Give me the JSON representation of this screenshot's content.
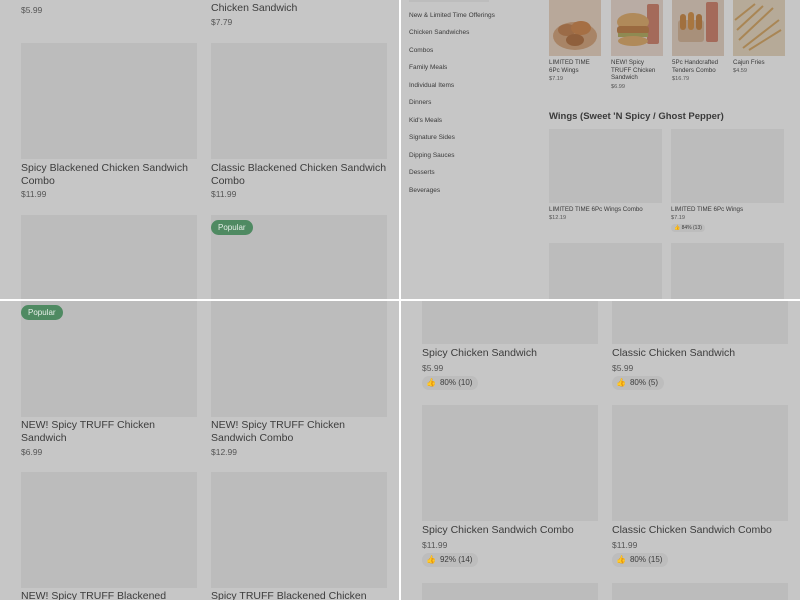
{
  "q1": {
    "top_row": [
      {
        "name": "",
        "price": "$5.99"
      },
      {
        "name": "Chicken Sandwich",
        "price": "$7.79"
      }
    ],
    "items": [
      {
        "name": "Spicy Blackened Chicken Sandwich Combo",
        "price": "$11.99"
      },
      {
        "name": "Classic Blackened Chicken Sandwich Combo",
        "price": "$11.99"
      }
    ],
    "popular_badge": "Popular"
  },
  "q2": {
    "sidebar": [
      "New & Limited Time Offerings",
      "Chicken Sandwiches",
      "Combos",
      "Family Meals",
      "Individual Items",
      "Dinners",
      "Kid's Meals",
      "Signature Sides",
      "Dipping Sauces",
      "Desserts",
      "Beverages"
    ],
    "featured": [
      {
        "name": "LIMITED TIME 6Pc Wings",
        "price": "$7.19"
      },
      {
        "name": "NEW! Spicy TRUFF Chicken Sandwich",
        "price": "$6.99"
      },
      {
        "name": "5Pc Handcrafted Tenders Combo",
        "price": "$16.79"
      },
      {
        "name": "Cajun Fries",
        "price": "$4.59"
      }
    ],
    "section_title": "Wings (Sweet 'N Spicy / Ghost Pepper)",
    "wings": [
      {
        "name": "LIMITED TIME 6Pc Wings Combo",
        "price": "$12.19",
        "rating": ""
      },
      {
        "name": "LIMITED TIME 6Pc Wings",
        "price": "$7.19",
        "rating": "84% (13)"
      }
    ]
  },
  "q3": {
    "popular_badge": "Popular",
    "items": [
      {
        "name": "NEW! Spicy TRUFF Chicken Sandwich",
        "price": "$6.99"
      },
      {
        "name": "NEW! Spicy TRUFF Chicken Sandwich Combo",
        "price": "$12.99"
      },
      {
        "name": "NEW! Spicy TRUFF Blackened",
        "price": ""
      },
      {
        "name": "Spicy TRUFF Blackened Chicken",
        "price": ""
      }
    ]
  },
  "q4": {
    "items": [
      {
        "name": "Spicy Chicken Sandwich",
        "price": "$5.99",
        "rating": "80% (10)"
      },
      {
        "name": "Classic Chicken Sandwich",
        "price": "$5.99",
        "rating": "80% (5)"
      },
      {
        "name": "Spicy Chicken Sandwich Combo",
        "price": "$11.99",
        "rating": "92% (14)"
      },
      {
        "name": "Classic Chicken Sandwich Combo",
        "price": "$11.99",
        "rating": "80% (15)"
      }
    ]
  },
  "icons": {
    "thumb": "thumbs-up-icon"
  },
  "colors": {
    "badge": "#4f8a62",
    "overlay": "#c6c6c6",
    "divider": "#ffffff"
  }
}
